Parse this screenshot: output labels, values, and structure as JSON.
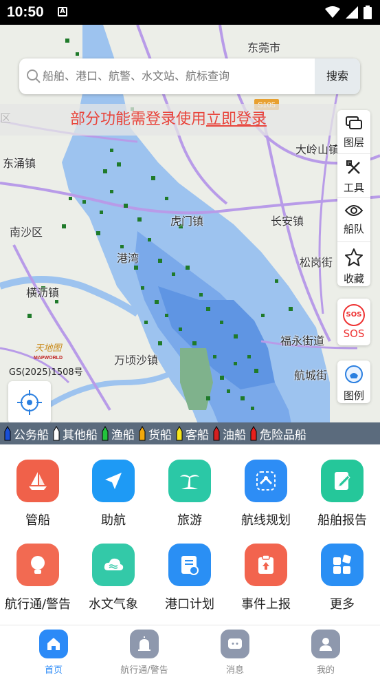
{
  "status_bar": {
    "time": "10:50",
    "notification_icon": "a-icon"
  },
  "map": {
    "labels": {
      "dongguan": "东莞市",
      "dongyong": "东涌镇",
      "nansha": "南沙区",
      "humen": "虎门镇",
      "changan": "长安镇",
      "dalingshan": "大岭山镇",
      "songgang": "松岗街",
      "fuyong": "福永街道",
      "hangcheng": "航城街",
      "wanqingsha": "万顷沙镇",
      "gangwan": "港湾",
      "hengli": "横沥镇",
      "qu": "区",
      "road_sign": "S105"
    },
    "search": {
      "placeholder": "船舶、港口、航警、水文站、航标查询",
      "button": "搜索"
    },
    "login_banner": {
      "text": "部分功能需登录使用",
      "link": "立即登录"
    },
    "side_panel": [
      {
        "label": "图层",
        "icon": "layers-icon"
      },
      {
        "label": "工具",
        "icon": "tools-icon"
      },
      {
        "label": "船队",
        "icon": "eye-icon"
      },
      {
        "label": "收藏",
        "icon": "star-icon"
      }
    ],
    "sos": {
      "badge": "SOS",
      "label": "SOS"
    },
    "legend": {
      "label": "图例",
      "icon": "legend-icon"
    },
    "watermark": {
      "logo": "天地图",
      "logo_sub": "MAPWORLD",
      "gs_number": "GS(2025)1508号"
    },
    "ship_legend": [
      {
        "label": "公务船",
        "color": "#1a4fd6"
      },
      {
        "label": "其他船",
        "color": "#ffffff"
      },
      {
        "label": "渔船",
        "color": "#22c43c"
      },
      {
        "label": "货船",
        "color": "#f2a80c"
      },
      {
        "label": "客船",
        "color": "#f5e51b"
      },
      {
        "label": "油船",
        "color": "#d42020"
      },
      {
        "label": "危险品船",
        "color": "#e8201c"
      }
    ]
  },
  "functions": {
    "row1": [
      {
        "label": "管船",
        "icon": "sailboat-icon",
        "color": "#f0614a"
      },
      {
        "label": "助航",
        "icon": "navigate-icon",
        "color": "#1e9af5"
      },
      {
        "label": "旅游",
        "icon": "palm-tree-icon",
        "color": "#2bc8a6"
      },
      {
        "label": "航线规划",
        "icon": "route-icon",
        "color": "#2d8df5"
      },
      {
        "label": "船舶报告",
        "icon": "report-icon",
        "color": "#25c79a"
      }
    ],
    "row2": [
      {
        "label": "航行通/警告",
        "icon": "bulb-icon",
        "color": "#f26a52"
      },
      {
        "label": "水文气象",
        "icon": "weather-icon",
        "color": "#33c9a8"
      },
      {
        "label": "港口计划",
        "icon": "port-plan-icon",
        "color": "#2a8ff4"
      },
      {
        "label": "事件上报",
        "icon": "event-report-icon",
        "color": "#f2644e"
      },
      {
        "label": "更多",
        "icon": "more-icon",
        "color": "#2a8ff4"
      }
    ]
  },
  "bottom_nav": [
    {
      "label": "首页",
      "icon": "home-icon",
      "active": true
    },
    {
      "label": "航行通/警告",
      "icon": "alarm-icon",
      "active": false
    },
    {
      "label": "消息",
      "icon": "message-icon",
      "active": false
    },
    {
      "label": "我的",
      "icon": "user-icon",
      "active": false
    }
  ]
}
